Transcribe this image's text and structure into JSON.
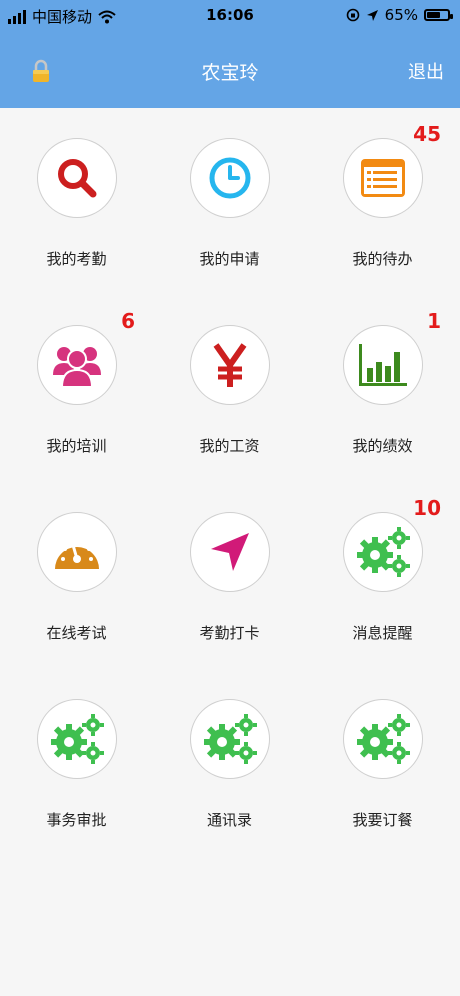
{
  "status_bar": {
    "carrier": "中国移动",
    "time": "16:06",
    "battery": "65%",
    "battery_level": 0.65
  },
  "header": {
    "title": "农宝玲",
    "logout_label": "退出"
  },
  "menu": [
    {
      "label": "我的考勤",
      "icon": "search-icon",
      "badge": ""
    },
    {
      "label": "我的申请",
      "icon": "clock-icon",
      "badge": ""
    },
    {
      "label": "我的待办",
      "icon": "list-icon",
      "badge": "45"
    },
    {
      "label": "我的培训",
      "icon": "people-icon",
      "badge": "6"
    },
    {
      "label": "我的工资",
      "icon": "yen-icon",
      "badge": ""
    },
    {
      "label": "我的绩效",
      "icon": "bar-chart-icon",
      "badge": "1"
    },
    {
      "label": "在线考试",
      "icon": "gauge-icon",
      "badge": ""
    },
    {
      "label": "考勤打卡",
      "icon": "location-arrow-icon",
      "badge": ""
    },
    {
      "label": "消息提醒",
      "icon": "gears-icon",
      "badge": "10"
    },
    {
      "label": "事务审批",
      "icon": "gears-icon",
      "badge": ""
    },
    {
      "label": "通讯录",
      "icon": "gears-icon",
      "badge": ""
    },
    {
      "label": "我要订餐",
      "icon": "gears-icon",
      "badge": ""
    }
  ],
  "colors": {
    "header": "#64a5e6",
    "badge": "#e31b1b",
    "search": "#cc1f1f",
    "clock": "#26b6ee",
    "list": "#f28a12",
    "people": "#d6337e",
    "yen": "#cc1f1f",
    "chart": "#3d8a1e",
    "gauge": "#d8891a",
    "arrow": "#d11a78",
    "gears": "#3fbf4f"
  }
}
